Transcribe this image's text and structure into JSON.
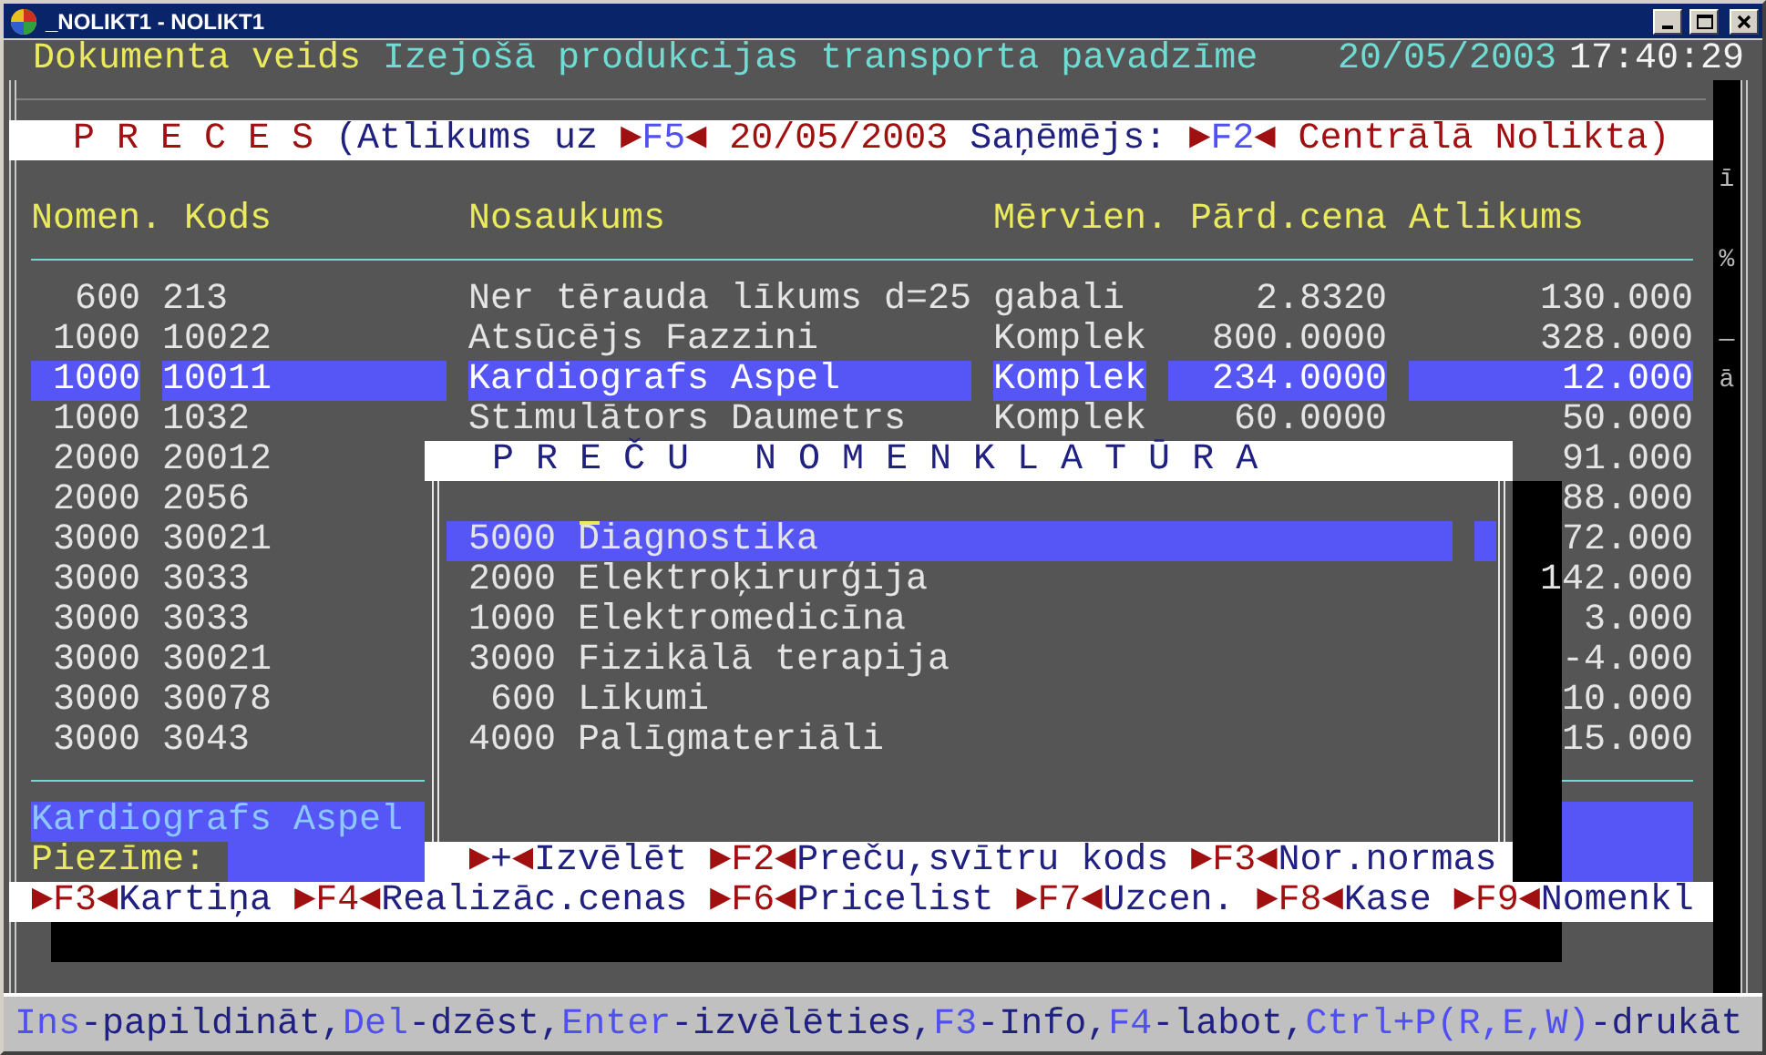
{
  "window": {
    "title": "_NOLIKT1 - NOLIKT1"
  },
  "header": {
    "label": "Dokumenta veids",
    "document_type": "Izejošā produkcijas transporta pavadzīme",
    "date": "20/05/2003",
    "time": "17:40:29"
  },
  "preces_bar": {
    "title": "P R E C E S",
    "parts": [
      {
        "kind": "label",
        "text": "(Atlikums uz"
      },
      {
        "kind": "key",
        "open": "►",
        "key": "F5",
        "close": "◄"
      },
      {
        "kind": "value",
        "text": "20/05/2003"
      },
      {
        "kind": "label",
        "text": "Saņēmējs:"
      },
      {
        "kind": "key",
        "open": "►",
        "key": "F2",
        "close": "◄"
      },
      {
        "kind": "value",
        "text": "Centrālā Nolikta)"
      }
    ]
  },
  "edge_marks": [
    "ī",
    "%",
    "—",
    "ā"
  ],
  "table": {
    "columns": [
      "Nomen.",
      "Kods",
      "Nosaukums",
      "Mērvien.",
      "Pārd.cena",
      "Atlikums"
    ],
    "rows": [
      {
        "nomen": "600",
        "kods": "213",
        "name": "Ner tērauda līkums d=25",
        "unit": "gabali",
        "price": "2.8320",
        "stock": "130.000",
        "selected": false
      },
      {
        "nomen": "1000",
        "kods": "10022",
        "name": "Atsūcējs Fazzini",
        "unit": "Komplek",
        "price": "800.0000",
        "stock": "328.000",
        "selected": false
      },
      {
        "nomen": "1000",
        "kods": "10011",
        "name": "Kardiografs Aspel",
        "unit": "Komplek",
        "price": "234.0000",
        "stock": "12.000",
        "selected": true
      },
      {
        "nomen": "1000",
        "kods": "1032",
        "name": "Stimulātors Daumetrs",
        "unit": "Komplek",
        "price": "60.0000",
        "stock": "50.000",
        "selected": false
      },
      {
        "nomen": "2000",
        "kods": "20012",
        "stock": "91.000",
        "selected": false
      },
      {
        "nomen": "2000",
        "kods": "2056",
        "stock": "88.000",
        "selected": false
      },
      {
        "nomen": "3000",
        "kods": "30021",
        "stock": "72.000",
        "selected": false
      },
      {
        "nomen": "3000",
        "kods": "3033",
        "stock": "142.000",
        "selected": false
      },
      {
        "nomen": "3000",
        "kods": "3033",
        "stock": "3.000",
        "selected": false
      },
      {
        "nomen": "3000",
        "kods": "30021",
        "stock": "-4.000",
        "selected": false
      },
      {
        "nomen": "3000",
        "kods": "30078",
        "stock": "10.000",
        "selected": false
      },
      {
        "nomen": "3000",
        "kods": "3043",
        "stock": "15.000",
        "selected": false
      }
    ]
  },
  "current_item": {
    "name": "Kardiografs Aspel",
    "note_label": "Piezīme:"
  },
  "function_keys": [
    {
      "open": "►",
      "key": "F3",
      "close": "◄",
      "label": "Kartiņa"
    },
    {
      "open": "►",
      "key": "F4",
      "close": "◄",
      "label": "Realizāc.cenas"
    },
    {
      "open": "►",
      "key": "F6",
      "close": "◄",
      "label": "Pricelist"
    },
    {
      "open": "►",
      "key": "F7",
      "close": "◄",
      "label": "Uzcen."
    },
    {
      "open": "►",
      "key": "F8",
      "close": "◄",
      "label": "Kase"
    },
    {
      "open": "►",
      "key": "F9",
      "close": "◄",
      "label": "Nomenkl"
    }
  ],
  "popup": {
    "title": "P R E Č U   N O M E N K L A T Ū R A",
    "items": [
      {
        "code": "5000",
        "name": "Diagnostika",
        "selected": true
      },
      {
        "code": "2000",
        "name": "Elektroķirurģija",
        "selected": false
      },
      {
        "code": "1000",
        "name": "Elektromedicīna",
        "selected": false
      },
      {
        "code": "3000",
        "name": "Fizikālā terapija",
        "selected": false
      },
      {
        "code": "600",
        "name": "Līkumi",
        "selected": false
      },
      {
        "code": "4000",
        "name": "Palīgmateriāli",
        "selected": false
      }
    ],
    "keys": [
      {
        "open": "►",
        "key": "+",
        "close": "◄",
        "label": "Izvēlēt"
      },
      {
        "open": "►",
        "key": "F2",
        "close": "◄",
        "label": "Preču,svītru kods"
      },
      {
        "open": "►",
        "key": "F3",
        "close": "◄",
        "label": "Nor.normas"
      }
    ]
  },
  "status_bar": [
    {
      "key": "Ins",
      "text": "-papildināt,"
    },
    {
      "key": "Del",
      "text": "-dzēst,"
    },
    {
      "key": "Enter",
      "text": "-izvēlēties,"
    },
    {
      "key": "F3",
      "text": "-Info,"
    },
    {
      "key": "F4",
      "text": "-labot,"
    },
    {
      "key": "Ctrl+P(R,E,W)",
      "text": "-drukāt"
    }
  ]
}
